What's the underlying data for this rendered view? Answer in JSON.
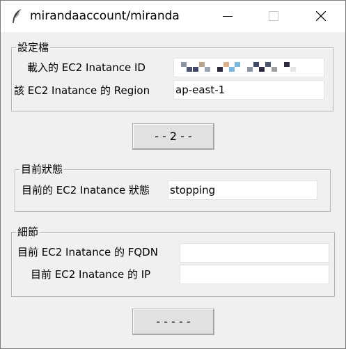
{
  "window": {
    "title": "mirandaaccount/miranda",
    "icon": "feather-icon",
    "controls": [
      "minimize-icon",
      "maximize-icon",
      "close-icon"
    ]
  },
  "settings": {
    "legend": "設定檔",
    "instance_id_label": "載入的 EC2 Inatance ID",
    "instance_id_value": "",
    "region_label": "該 EC2 Inatance 的 Region",
    "region_value": "ap-east-1"
  },
  "toggle_button": {
    "label": "- - 2 - -"
  },
  "status": {
    "legend": "目前狀態",
    "state_label": "目前的 EC2 Inatance 狀態",
    "state_value": "stopping"
  },
  "details": {
    "legend": "細節",
    "fqdn_label": "目前 EC2 Inatance 的 FQDN",
    "fqdn_value": "",
    "ip_label": "目前 EC2 Inatance 的 IP",
    "ip_value": ""
  },
  "bottom_button": {
    "label": "- - - - -"
  },
  "colors": {
    "window_bg": "#f0f0f0",
    "titlebar_bg": "#ffffff",
    "entry_bg": "#ffffff",
    "button_bg": "#e1e1e1",
    "obscured_pixels": [
      "#8c94a6",
      "#d9b38c",
      "#4c5573",
      "#9aa5b8",
      "#b8a48a",
      "#3f4a6b",
      "#7bb6e0",
      "#e6e6e6",
      "#2b2b44",
      "#a0a0a0"
    ]
  }
}
